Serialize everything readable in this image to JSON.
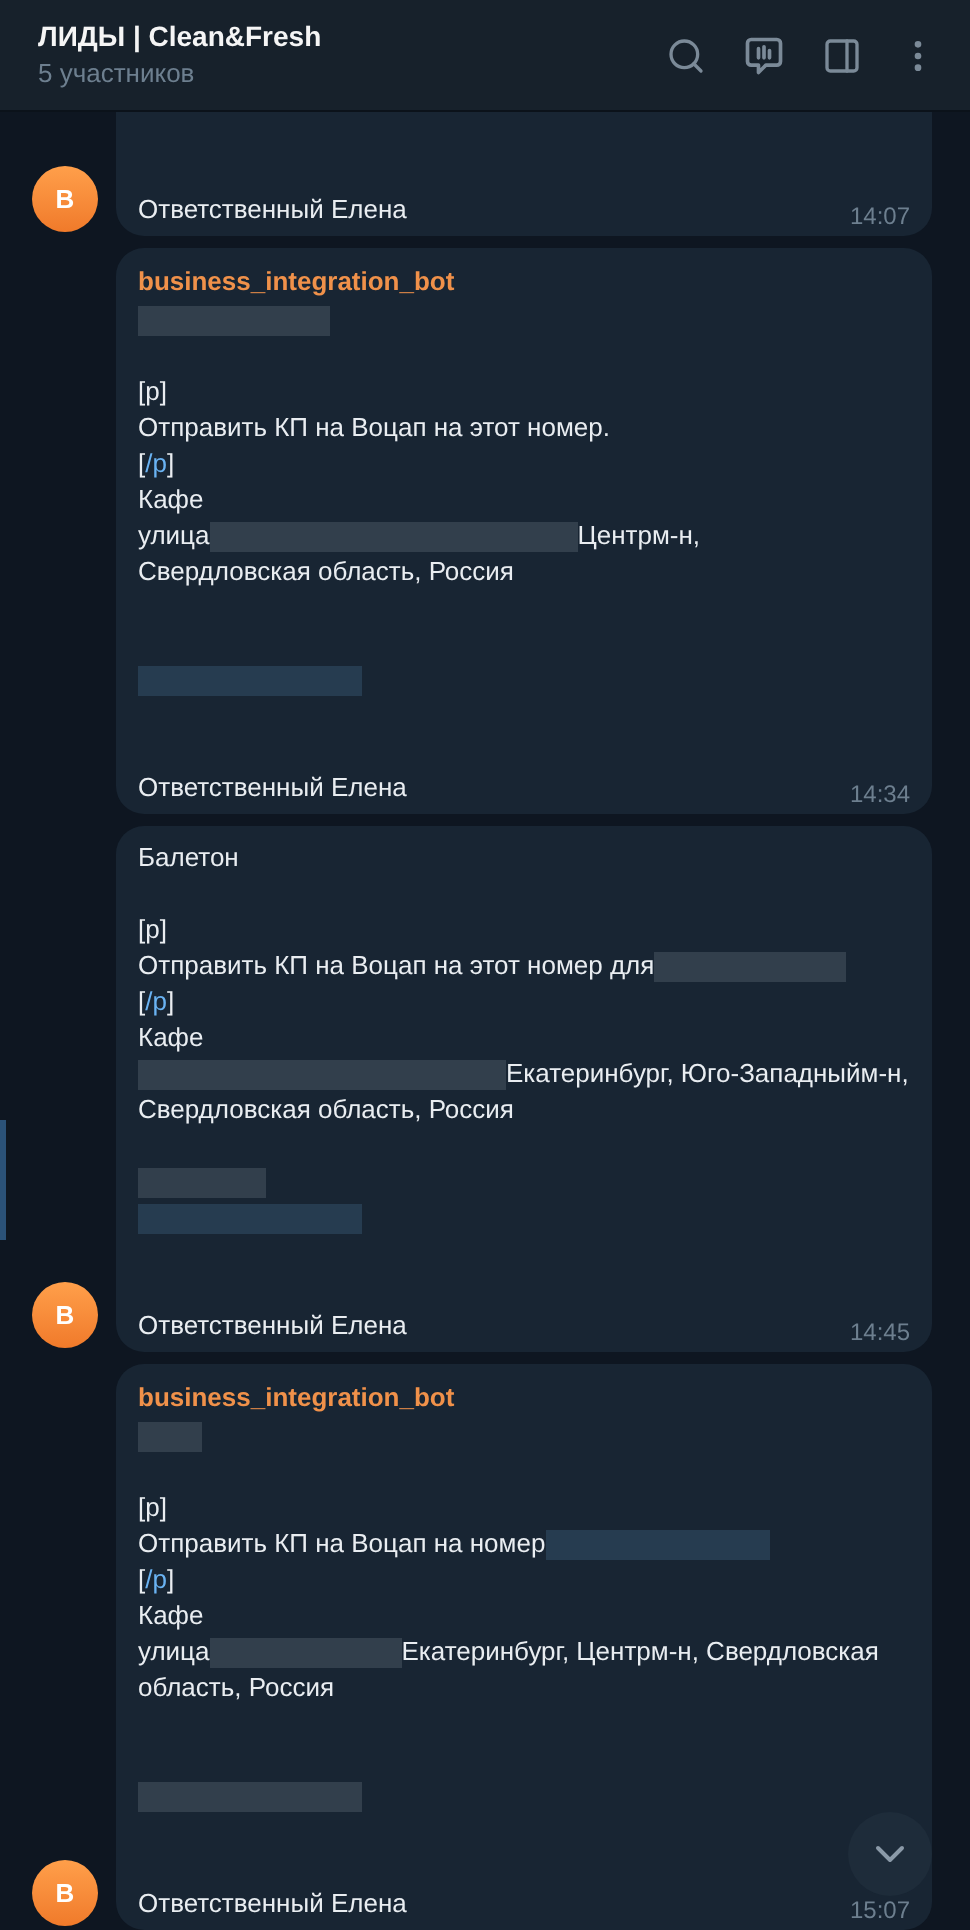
{
  "header": {
    "title": "ЛИДЫ | Clean&Fresh",
    "subtitle": "5 участников"
  },
  "messages": [
    {
      "avatar": "В",
      "cut_top": true,
      "signature": "Ответственный Елена",
      "time": "14:07"
    },
    {
      "sender": "business_integration_bot",
      "cut_top": false,
      "lines": [
        {
          "kind": "line",
          "parts": [
            {
              "kind": "blur_m",
              "link": false
            }
          ]
        },
        {
          "kind": "blank"
        },
        {
          "kind": "line",
          "parts": [
            {
              "kind": "text",
              "text": "[p]"
            }
          ]
        },
        {
          "kind": "line",
          "parts": [
            {
              "kind": "text",
              "text": "Отправить КП на Воцап на этот номер."
            }
          ]
        },
        {
          "kind": "line",
          "parts": [
            {
              "kind": "text",
              "text": "["
            },
            {
              "kind": "command",
              "text": "/p"
            },
            {
              "kind": "text",
              "text": "]"
            }
          ]
        },
        {
          "kind": "line",
          "parts": [
            {
              "kind": "text",
              "text": "Кафе"
            }
          ]
        },
        {
          "kind": "line",
          "parts": [
            {
              "kind": "text",
              "text": "улица"
            },
            {
              "kind": "blur_xl",
              "link": false
            },
            {
              "kind": "text",
              "text": "Центрм-н,"
            }
          ]
        },
        {
          "kind": "line",
          "parts": [
            {
              "kind": "text",
              "text": "Свердловская область, Россия"
            }
          ]
        },
        {
          "kind": "blank"
        },
        {
          "kind": "blank"
        },
        {
          "kind": "line",
          "parts": [
            {
              "kind": "blur_l",
              "link": true
            }
          ]
        },
        {
          "kind": "blank"
        },
        {
          "kind": "blank"
        }
      ],
      "signature": "Ответственный Елена",
      "time": "14:34"
    },
    {
      "avatar": "В",
      "cut_top": false,
      "lines": [
        {
          "kind": "line",
          "parts": [
            {
              "kind": "text",
              "text": "Балетон"
            }
          ]
        },
        {
          "kind": "blank"
        },
        {
          "kind": "line",
          "parts": [
            {
              "kind": "text",
              "text": "[p]"
            }
          ]
        },
        {
          "kind": "line",
          "parts": [
            {
              "kind": "text",
              "text": "Отправить КП на Воцап на этот номер для "
            },
            {
              "kind": "blur_m",
              "link": false
            }
          ]
        },
        {
          "kind": "line",
          "parts": [
            {
              "kind": "text",
              "text": "["
            },
            {
              "kind": "command",
              "text": "/p"
            },
            {
              "kind": "text",
              "text": "]"
            }
          ]
        },
        {
          "kind": "line",
          "parts": [
            {
              "kind": "text",
              "text": "Кафе"
            }
          ]
        },
        {
          "kind": "line",
          "parts": [
            {
              "kind": "blur_xl",
              "link": false
            },
            {
              "kind": "text",
              "text": "Екатеринбург, Юго-Западныйм-н,"
            }
          ]
        },
        {
          "kind": "line",
          "parts": [
            {
              "kind": "text",
              "text": "Свердловская область, Россия"
            }
          ]
        },
        {
          "kind": "blank"
        },
        {
          "kind": "line",
          "parts": [
            {
              "kind": "blur_s",
              "link": false
            }
          ]
        },
        {
          "kind": "line",
          "parts": [
            {
              "kind": "blur_l",
              "link": true
            }
          ]
        },
        {
          "kind": "blank"
        },
        {
          "kind": "blank"
        }
      ],
      "signature": "Ответственный Елена",
      "time": "14:45"
    },
    {
      "avatar": "В",
      "sender": "business_integration_bot",
      "cut_top": false,
      "lines": [
        {
          "kind": "line",
          "parts": [
            {
              "kind": "blur_xs",
              "link": false
            }
          ]
        },
        {
          "kind": "blank"
        },
        {
          "kind": "line",
          "parts": [
            {
              "kind": "text",
              "text": "[p]"
            }
          ]
        },
        {
          "kind": "line",
          "parts": [
            {
              "kind": "text",
              "text": "Отправить КП на Воцап на номер"
            },
            {
              "kind": "blur_l",
              "link": true
            }
          ]
        },
        {
          "kind": "line",
          "parts": [
            {
              "kind": "text",
              "text": "["
            },
            {
              "kind": "command",
              "text": "/p"
            },
            {
              "kind": "text",
              "text": "]"
            }
          ]
        },
        {
          "kind": "line",
          "parts": [
            {
              "kind": "text",
              "text": "Кафе"
            }
          ]
        },
        {
          "kind": "line",
          "parts": [
            {
              "kind": "text",
              "text": "улица "
            },
            {
              "kind": "blur_m",
              "link": false
            },
            {
              "kind": "text",
              "text": "Екатеринбург, Центрм-н, Свердловская"
            }
          ]
        },
        {
          "kind": "line",
          "parts": [
            {
              "kind": "text",
              "text": "область, Россия"
            }
          ]
        },
        {
          "kind": "blank"
        },
        {
          "kind": "blank"
        },
        {
          "kind": "line",
          "parts": [
            {
              "kind": "blur_l",
              "link": false
            }
          ]
        },
        {
          "kind": "blank"
        },
        {
          "kind": "blank"
        }
      ],
      "signature": "Ответственный Елена",
      "time": "15:07"
    }
  ]
}
